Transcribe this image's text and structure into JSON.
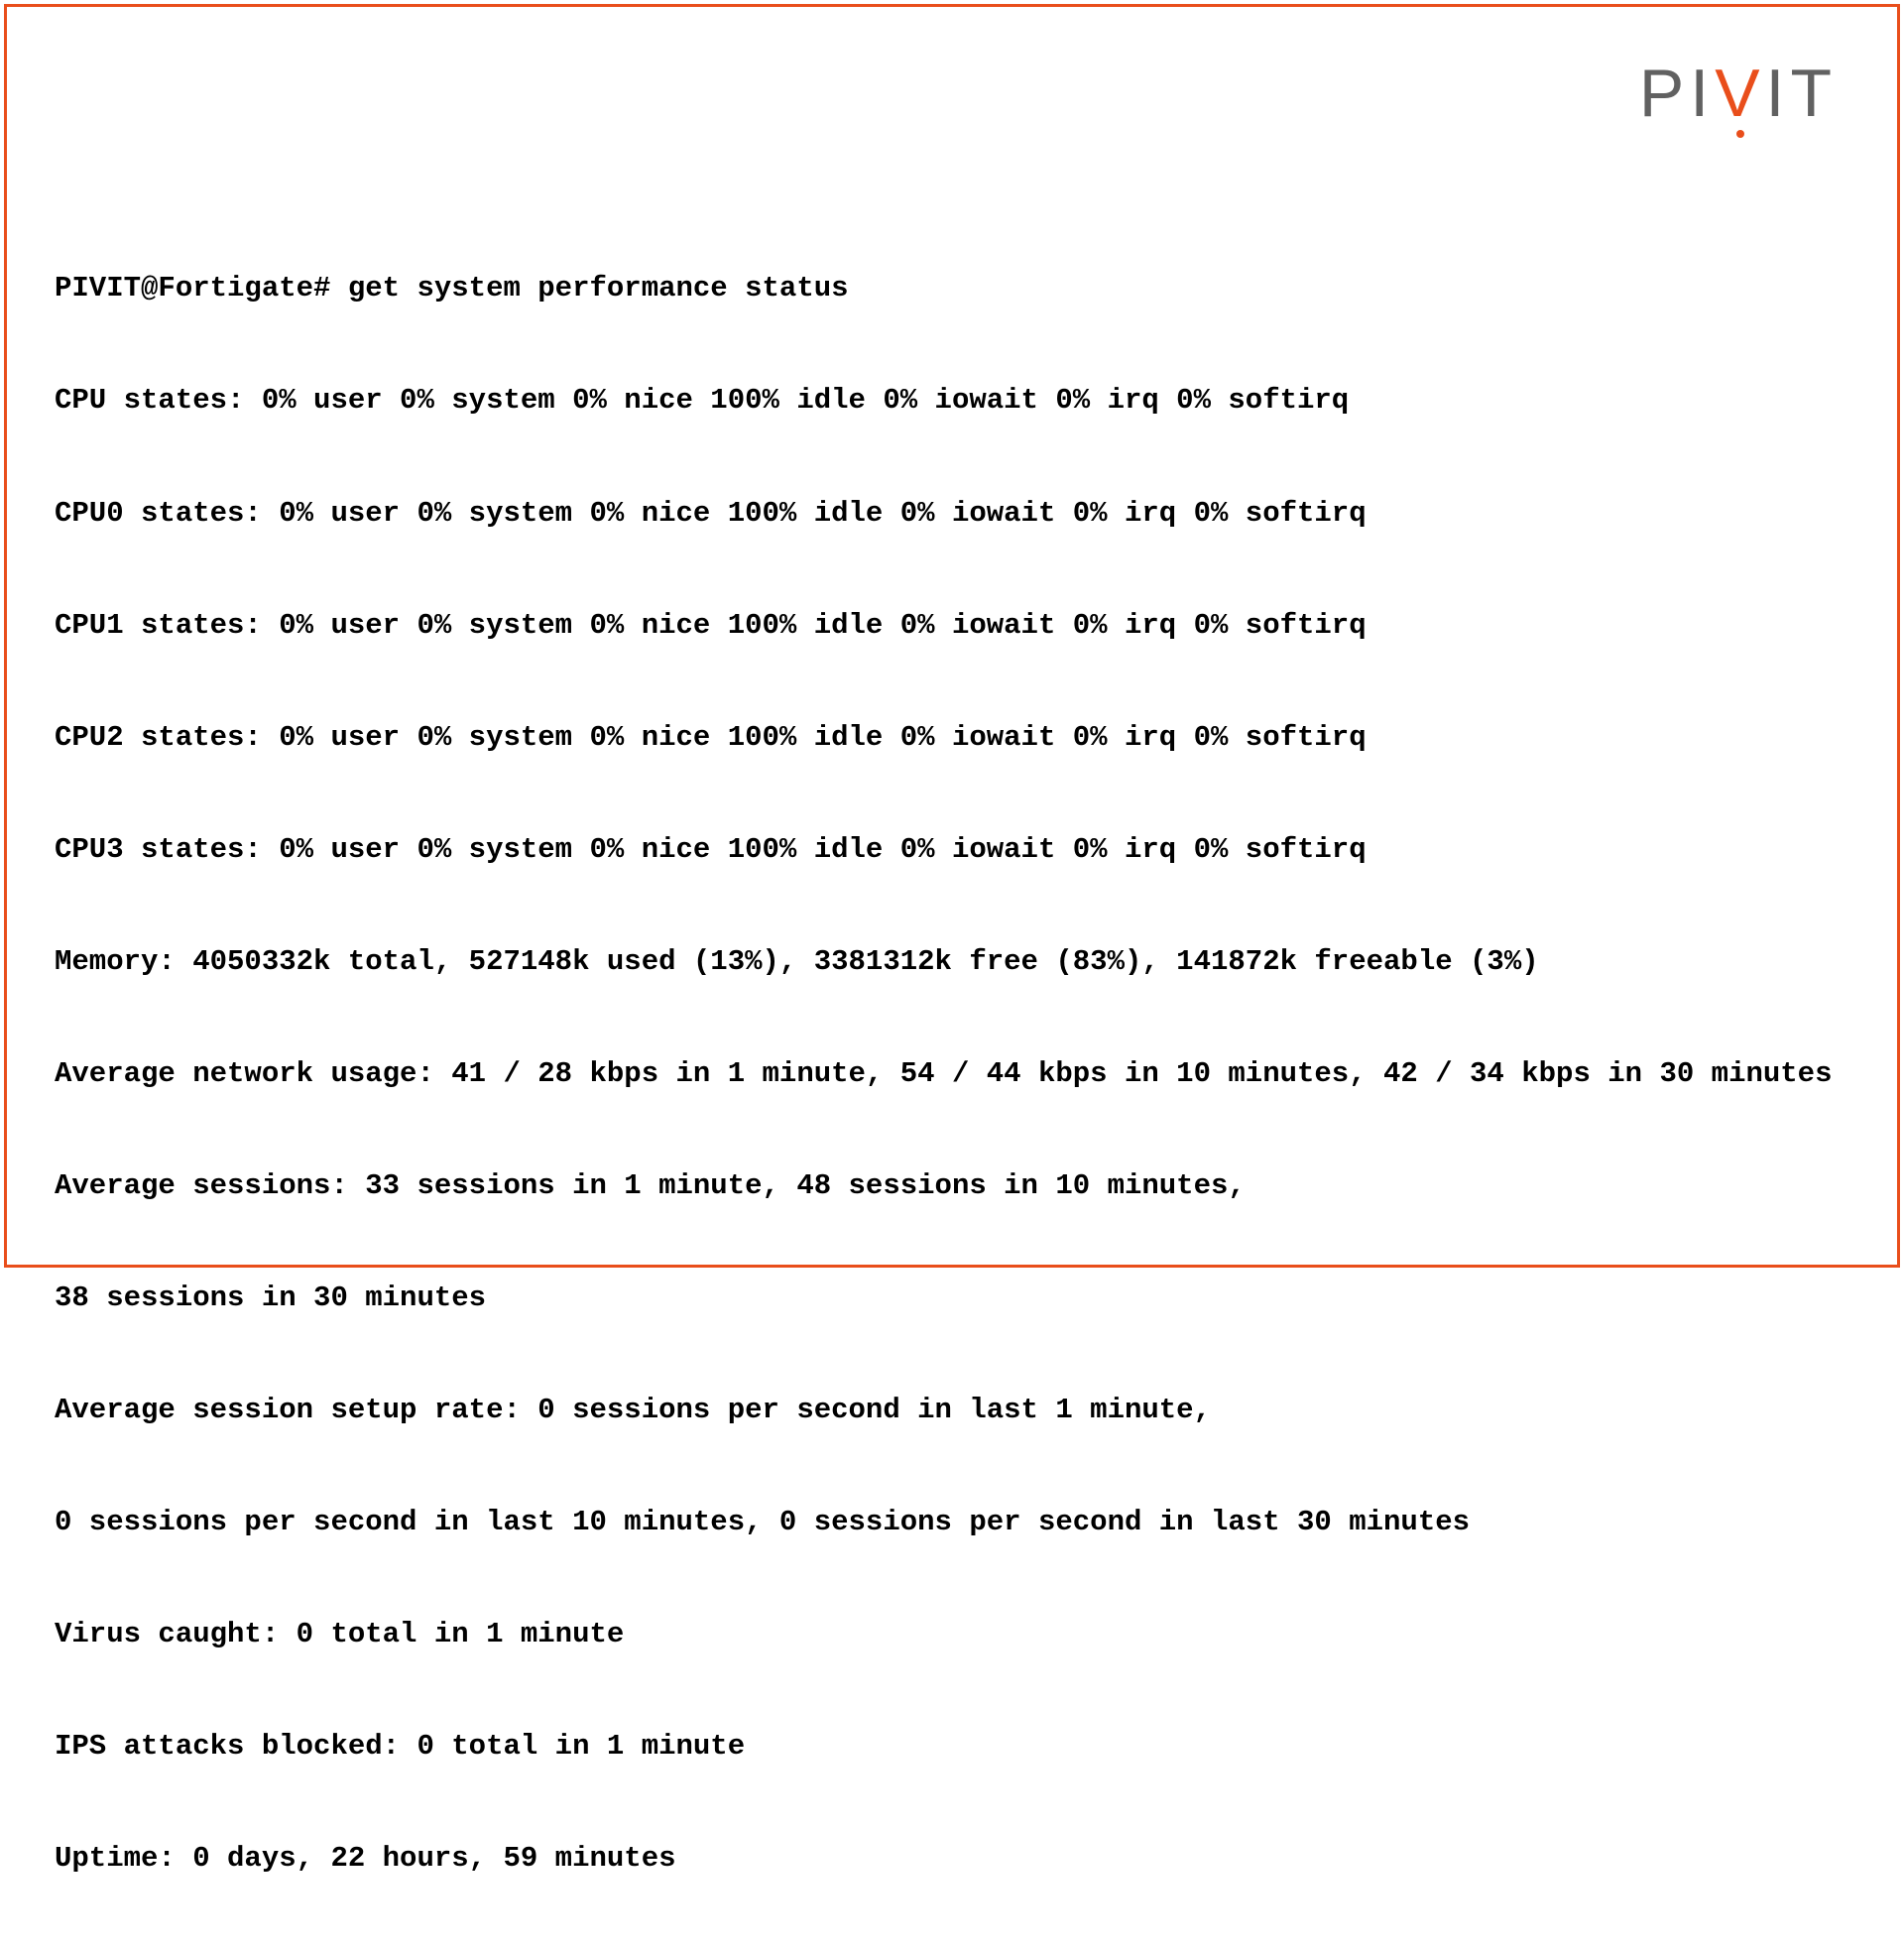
{
  "brand": {
    "p1": "P",
    "i1": "I",
    "v": "V",
    "i2": "I",
    "t": "T"
  },
  "terminal": {
    "lines": [
      "PIVIT@Fortigate# get system performance status",
      "CPU states: 0% user 0% system 0% nice 100% idle 0% iowait 0% irq 0% softirq",
      "CPU0 states: 0% user 0% system 0% nice 100% idle 0% iowait 0% irq 0% softirq",
      "CPU1 states: 0% user 0% system 0% nice 100% idle 0% iowait 0% irq 0% softirq",
      "CPU2 states: 0% user 0% system 0% nice 100% idle 0% iowait 0% irq 0% softirq",
      "CPU3 states: 0% user 0% system 0% nice 100% idle 0% iowait 0% irq 0% softirq",
      "Memory: 4050332k total, 527148k used (13%), 3381312k free (83%), 141872k freeable (3%)",
      "Average network usage: 41 / 28 kbps in 1 minute, 54 / 44 kbps in 10 minutes, 42 / 34 kbps in 30 minutes",
      "Average sessions: 33 sessions in 1 minute, 48 sessions in 10 minutes,",
      "38 sessions in 30 minutes",
      "Average session setup rate: 0 sessions per second in last 1 minute,",
      "0 sessions per second in last 10 minutes, 0 sessions per second in last 30 minutes",
      "Virus caught: 0 total in 1 minute",
      "IPS attacks blocked: 0 total in 1 minute",
      "Uptime: 0 days, 22 hours, 59 minutes"
    ]
  }
}
